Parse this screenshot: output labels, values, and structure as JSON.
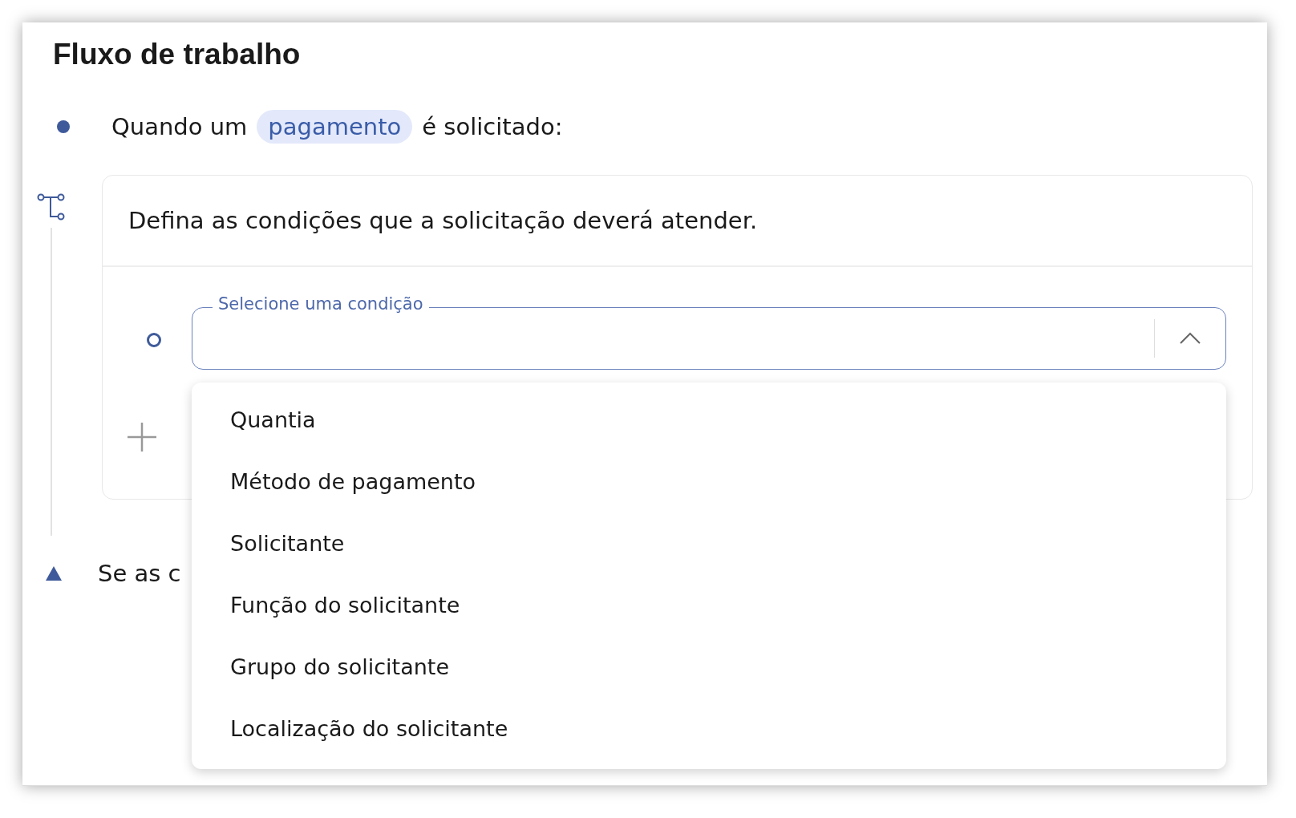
{
  "title": "Fluxo de trabalho",
  "trigger": {
    "before": "Quando um",
    "tag": "pagamento",
    "after": "é solicitado:"
  },
  "conditions_card": {
    "heading": "Defina as condições que a solicitação deverá atender.",
    "condition_field": {
      "label": "Selecione uma condição",
      "expanded": true,
      "options": [
        {
          "label": "Quantia"
        },
        {
          "label": "Método de pagamento"
        },
        {
          "label": "Solicitante"
        },
        {
          "label": "Função do solicitante"
        },
        {
          "label": "Grupo do solicitante"
        },
        {
          "label": "Localização do solicitante"
        }
      ]
    }
  },
  "result": {
    "text": "Se as c"
  }
}
